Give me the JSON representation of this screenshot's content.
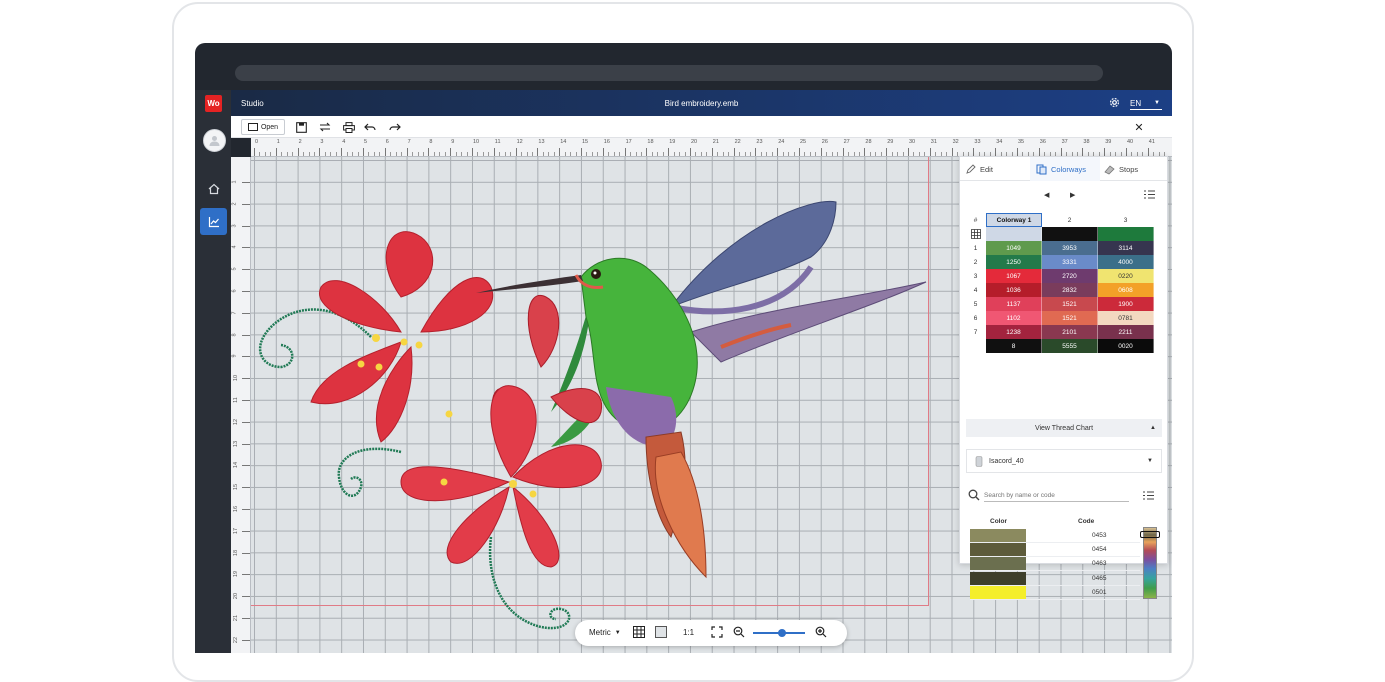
{
  "window": {
    "app_badge": "Wo",
    "app_name": "Studio",
    "file_name": "Bird embroidery.emb",
    "language": "EN"
  },
  "toolbar": {
    "open_label": "Open"
  },
  "ruler": {
    "top_ticks": [
      "0",
      "1",
      "2",
      "3",
      "4",
      "5",
      "6",
      "7",
      "8",
      "9",
      "10",
      "11",
      "12",
      "13",
      "14",
      "15",
      "16",
      "17",
      "18",
      "19",
      "20",
      "21",
      "22",
      "23",
      "24",
      "25",
      "26",
      "27",
      "28",
      "29",
      "30",
      "31",
      "32",
      "33",
      "34",
      "35",
      "36",
      "37",
      "38",
      "39",
      "40",
      "41"
    ],
    "left_ticks": [
      "1",
      "2",
      "3",
      "4",
      "5",
      "6",
      "7",
      "8",
      "9",
      "10",
      "11",
      "12",
      "13",
      "14",
      "15",
      "16",
      "17",
      "18",
      "19",
      "20",
      "21",
      "22",
      "23"
    ]
  },
  "panel": {
    "tabs": [
      {
        "label": "Edit",
        "icon": "pencil-icon"
      },
      {
        "label": "Colorways",
        "icon": "colorways-icon"
      },
      {
        "label": "Stops",
        "icon": "stops-icon"
      }
    ],
    "table_header": [
      "#",
      "Colorway 1",
      "2",
      "3"
    ],
    "header_colors": [
      "#cfd8e6",
      "#111111",
      "#1e7a3c"
    ],
    "rows": [
      {
        "n": "1",
        "cells": [
          {
            "code": "1049",
            "color": "#5f9a4d"
          },
          {
            "code": "3953",
            "color": "#4a6d8f"
          },
          {
            "code": "3114",
            "color": "#36354f"
          }
        ]
      },
      {
        "n": "2",
        "cells": [
          {
            "code": "1250",
            "color": "#237a4a"
          },
          {
            "code": "3331",
            "color": "#6a8bc9"
          },
          {
            "code": "4000",
            "color": "#3b6f89"
          }
        ]
      },
      {
        "n": "3",
        "cells": [
          {
            "code": "1067",
            "color": "#e42a3a"
          },
          {
            "code": "2720",
            "color": "#6e3b6e"
          },
          {
            "code": "0220",
            "color": "#f0e470"
          }
        ]
      },
      {
        "n": "4",
        "cells": [
          {
            "code": "1036",
            "color": "#b51d2a"
          },
          {
            "code": "2832",
            "color": "#7a3c5c"
          },
          {
            "code": "0608",
            "color": "#f3a128"
          }
        ]
      },
      {
        "n": "5",
        "cells": [
          {
            "code": "1137",
            "color": "#e0405a"
          },
          {
            "code": "1521",
            "color": "#c8494e"
          },
          {
            "code": "1900",
            "color": "#cc2a3a"
          }
        ]
      },
      {
        "n": "6",
        "cells": [
          {
            "code": "1102",
            "color": "#f05773"
          },
          {
            "code": "1521",
            "color": "#e06a52"
          },
          {
            "code": "0781",
            "color": "#f3d8c0"
          }
        ]
      },
      {
        "n": "7",
        "cells": [
          {
            "code": "1238",
            "color": "#a3233e"
          },
          {
            "code": "2101",
            "color": "#8a3850"
          },
          {
            "code": "2211",
            "color": "#79314d"
          }
        ]
      },
      {
        "n": "",
        "cells": [
          {
            "code": "8",
            "color": "#101010"
          },
          {
            "code": "5555",
            "color": "#2a4a2a"
          },
          {
            "code": "0020",
            "color": "#0b0b0b"
          }
        ]
      }
    ],
    "thread_chart_label": "View Thread Chart",
    "thread_brand": "Isacord_40",
    "search_placeholder": "Search by name or code",
    "color_col": "Color",
    "code_col": "Code",
    "threads": [
      {
        "code": "0453",
        "color": "#8b8a5f"
      },
      {
        "code": "0454",
        "color": "#5d5b3b"
      },
      {
        "code": "0463",
        "color": "#6b6f4f"
      },
      {
        "code": "0465",
        "color": "#3e3f2b"
      },
      {
        "code": "0501",
        "color": "#f4ee2a"
      }
    ]
  },
  "bottombar": {
    "unit": "Metric",
    "ratio": "1:1",
    "zoom_level": 0.55
  }
}
